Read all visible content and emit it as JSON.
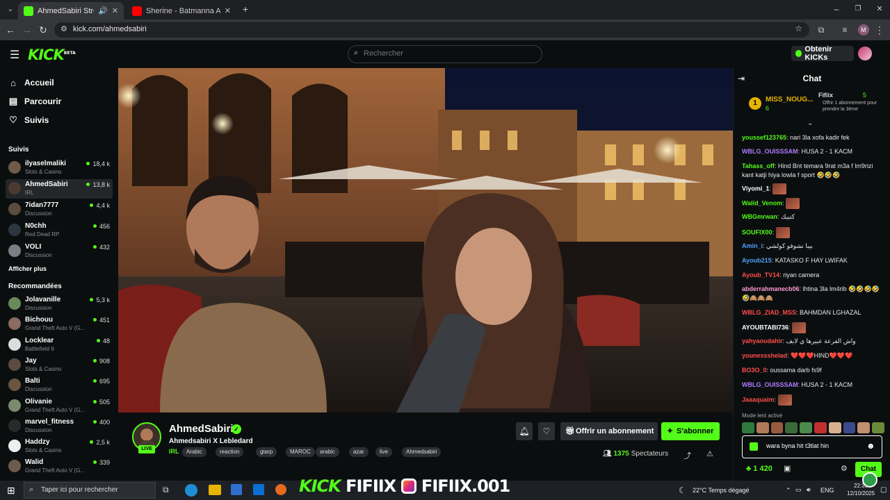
{
  "browser": {
    "tabs": [
      {
        "title": "AhmedSabiri Stream - Watc",
        "color": "#53fc18",
        "icon": "kick-favicon"
      },
      {
        "title": "Sherine - Batmanna Ansak | نك",
        "color": "#ff0000",
        "icon": "youtube-favicon"
      }
    ],
    "url": "kick.com/ahmedsabiri",
    "profile_initial": "M"
  },
  "kick": {
    "logo": "KICK",
    "logo_sup": "BETA",
    "search_placeholder": "Rechercher",
    "get_kicks": "Obtenir KICKs",
    "accent": "#53fc18"
  },
  "sidebar": {
    "nav": [
      {
        "label": "Accueil",
        "icon": "home-icon"
      },
      {
        "label": "Parcourir",
        "icon": "browse-icon"
      },
      {
        "label": "Suivis",
        "icon": "heart-icon"
      }
    ],
    "followed_heading": "Suivis",
    "followed": [
      {
        "name": "ilyaselmaliki",
        "category": "Slots & Casino",
        "viewers": "18,4 k",
        "color": "#6d5a48"
      },
      {
        "name": "AhmedSabiri",
        "category": "IRL",
        "viewers": "13,8 k",
        "color": "#4a3a30",
        "selected": true
      },
      {
        "name": "7idan7777",
        "category": "Discussion",
        "viewers": "4,4 k",
        "color": "#5b4b3e"
      },
      {
        "name": "N0chh",
        "category": "Red Dead RP",
        "viewers": "456",
        "color": "#2d3540"
      },
      {
        "name": "VOLI",
        "category": "Discussion",
        "viewers": "432",
        "color": "#7b7f85"
      }
    ],
    "show_more": "Afficher plus",
    "recommended_heading": "Recommandées",
    "recommended": [
      {
        "name": "Jolavanille",
        "category": "Discussion",
        "viewers": "5,3 k",
        "color": "#6a8a5a"
      },
      {
        "name": "Bichouu",
        "category": "Grand Theft Auto V (G...",
        "viewers": "451",
        "color": "#8a6b60"
      },
      {
        "name": "Locklear",
        "category": "Battlefield 6",
        "viewers": "48",
        "color": "#dddddd"
      },
      {
        "name": "Jay",
        "category": "Slots & Casino",
        "viewers": "908",
        "color": "#5a4b43"
      },
      {
        "name": "Balti",
        "category": "Discussion",
        "viewers": "695",
        "color": "#6b5540"
      },
      {
        "name": "Olivanie",
        "category": "Grand Theft Auto V (G...",
        "viewers": "505",
        "color": "#7a8b6c"
      },
      {
        "name": "marvel_fitness",
        "category": "Discussion",
        "viewers": "400",
        "color": "#2a2a2a"
      },
      {
        "name": "Haddzy",
        "category": "Slots & Casino",
        "viewers": "2,5 k",
        "color": "#eeeeee"
      },
      {
        "name": "Walid",
        "category": "Grand Theft Auto V (G...",
        "viewers": "339",
        "color": "#6c5a4a"
      }
    ]
  },
  "stream": {
    "name": "AhmedSabiri",
    "title": "Ahmedsabiri X Lebledard",
    "category": "IRL",
    "live": "LIVE",
    "tags": [
      "Arabic",
      "reaction",
      "gtarp",
      "MAROC",
      "arabic",
      "azar",
      "live",
      "Ahmedsabiri"
    ],
    "subscribe_gift": "Offrir un abonnement",
    "subscribe": "S'abonner",
    "viewers": "1375",
    "viewers_label": "Spectateurs"
  },
  "chat": {
    "title": "Chat",
    "pinned": {
      "rank": "1",
      "user": "MISS_NOUG...",
      "count": "6",
      "gifter": "Fifiix",
      "gift_count": "5",
      "gift_text": "Offrir 1 abonnement pour prendre la 3ème"
    },
    "messages": [
      {
        "user": "youssef123765",
        "color": "#53fc18",
        "text": "nari 3la xofa kadir fek"
      },
      {
        "user": "WBLG_OUISSSAM",
        "color": "#b07cff",
        "text": "HUSA 2 - 1 KACM"
      },
      {
        "user": "Tahass_off",
        "color": "#53fc18",
        "text": "Hind Bnt temara 9rat m3a f lm9rizi kant katji hiya lowla f sport 🤣🤣🤣"
      },
      {
        "user": "Viyomi_1",
        "color": "#ffffff",
        "text": ""
      },
      {
        "user": "Walid_Venom",
        "color": "#53fc18",
        "text": ""
      },
      {
        "user": "WBGmrwan",
        "color": "#53fc18",
        "text": "كتبيك"
      },
      {
        "user": "SOUFIX00",
        "color": "#53fc18",
        "text": ""
      },
      {
        "user": "Amin_i",
        "color": "#4ea1ff",
        "text": "بيبا نشوفو كولشي"
      },
      {
        "user": "Ayoub215",
        "color": "#4ea1ff",
        "text": "KATASKO F HAY LWIFAK"
      },
      {
        "user": "Ayoub_TV14",
        "color": "#ff4d4d",
        "text": "riyan camera"
      },
      {
        "user": "abderrahmanecb06",
        "color": "#ff9bd2",
        "text": "lhtina 3la lm4rib 🤣🤣🤣🤣🤣🙈🙈🙈"
      },
      {
        "user": "WBLG_ZIAD_MSS",
        "color": "#ff4d4d",
        "text": "BAHMDAN LGHAZAL"
      },
      {
        "user": "AYOUBTABI736",
        "color": "#ffffff",
        "text": ""
      },
      {
        "user": "yahyaoudahir",
        "color": "#ff4d4d",
        "text": "واش الفرعة عبيرها ي لايف"
      },
      {
        "user": "younessshelad",
        "color": "#ff4d4d",
        "text": "❤️❤️❤️HIND❤️❤️❤️"
      },
      {
        "user": "BO3O_0",
        "color": "#ff4d4d",
        "text": "oussama darb fs9f"
      },
      {
        "user": "WBLG_OUISSSAM",
        "color": "#b07cff",
        "text": "HUSA 2 - 1 KACM"
      },
      {
        "user": "Jaaaquaim",
        "color": "#ff4d4d",
        "text": ""
      }
    ],
    "slow_mode": "Mode lent activé",
    "input_value": "wara byna hit t3tlat hin",
    "points": "1 420",
    "send": "Chat"
  },
  "taskbar": {
    "search_placeholder": "Taper ici pour rechercher",
    "weather": "22°C  Temps dégagé",
    "lang": "ENG",
    "time": "22:35",
    "date": "12/10/2025"
  },
  "overlay": {
    "kick": "KICK",
    "fifiix": "FIFIIX",
    "insta": "FIFIIX.001"
  }
}
